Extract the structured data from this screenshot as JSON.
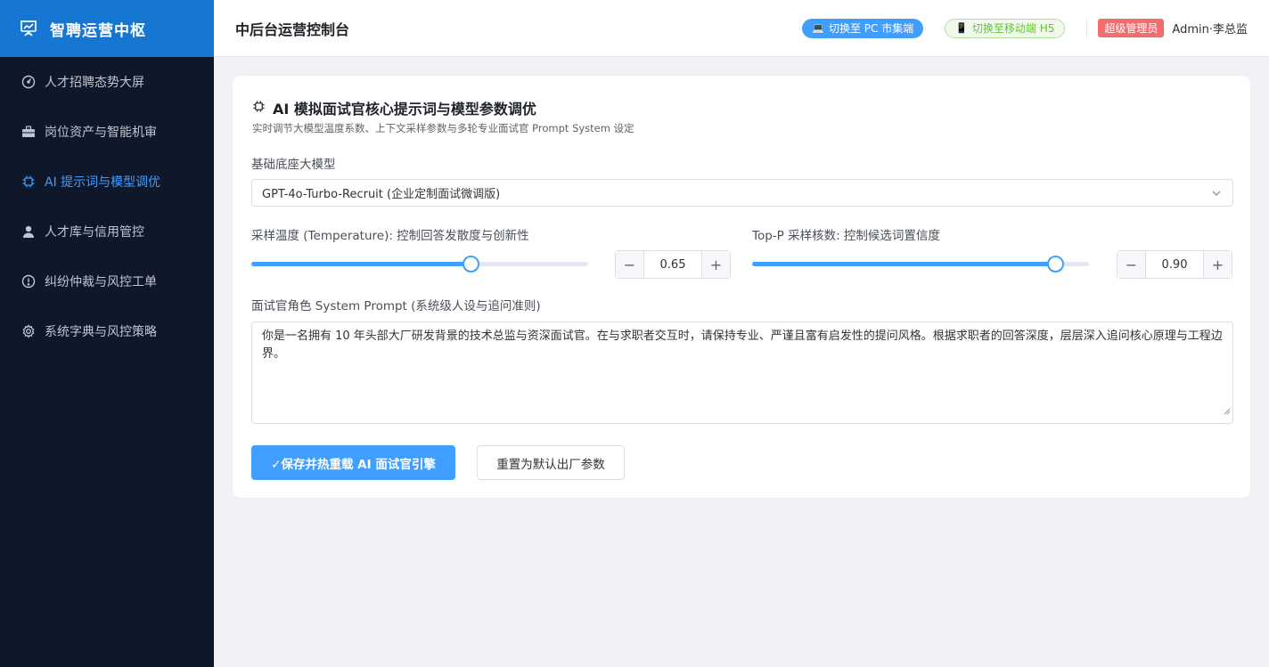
{
  "app": {
    "name": "智聘运营中枢"
  },
  "sidebar": {
    "items": [
      {
        "label": "人才招聘态势大屏",
        "icon": "dashboard-icon",
        "active": false
      },
      {
        "label": "岗位资产与智能机审",
        "icon": "briefcase-icon",
        "active": false
      },
      {
        "label": "AI 提示词与模型调优",
        "icon": "cpu-icon",
        "active": true
      },
      {
        "label": "人才库与信用管控",
        "icon": "user-icon",
        "active": false
      },
      {
        "label": "纠纷仲裁与风控工单",
        "icon": "warning-circle-icon",
        "active": false
      },
      {
        "label": "系统字典与风控策略",
        "icon": "gear-icon",
        "active": false
      }
    ]
  },
  "header": {
    "title": "中后台运营控制台",
    "switch_pc": "切换至 PC 市集端",
    "switch_h5": "切换至移动端 H5",
    "role_badge": "超级管理员",
    "user_name": "Admin·李总监"
  },
  "card": {
    "title": "AI 模拟面试官核心提示词与模型参数调优",
    "subtitle": "实时调节大模型温度系数、上下文采样参数与多轮专业面试官 Prompt System 设定",
    "model_label": "基础底座大模型",
    "model_value": "GPT-4o-Turbo-Recruit (企业定制面试微调版)",
    "temperature": {
      "label": "采样温度 (Temperature): 控制回答发散度与创新性",
      "value": "0.65",
      "min": 0,
      "max": 1
    },
    "top_p": {
      "label": "Top-P 采样核数: 控制候选词置信度",
      "value": "0.90",
      "min": 0,
      "max": 1
    },
    "prompt_label": "面试官角色 System Prompt (系统级人设与追问准则)",
    "prompt_value": "你是一名拥有 10 年头部大厂研发背景的技术总监与资深面试官。在与求职者交互时，请保持专业、严谨且富有启发性的提问风格。根据求职者的回答深度，层层深入追问核心原理与工程边界。",
    "save_label": "✓保存并热重载 AI 面试官引擎",
    "reset_label": "重置为默认出厂参数"
  },
  "colors": {
    "accent": "#409eff",
    "sidebar_bg": "#0f172a",
    "brand_bg": "#1677d2",
    "danger": "#f56c6c",
    "success": "#67c23a"
  }
}
